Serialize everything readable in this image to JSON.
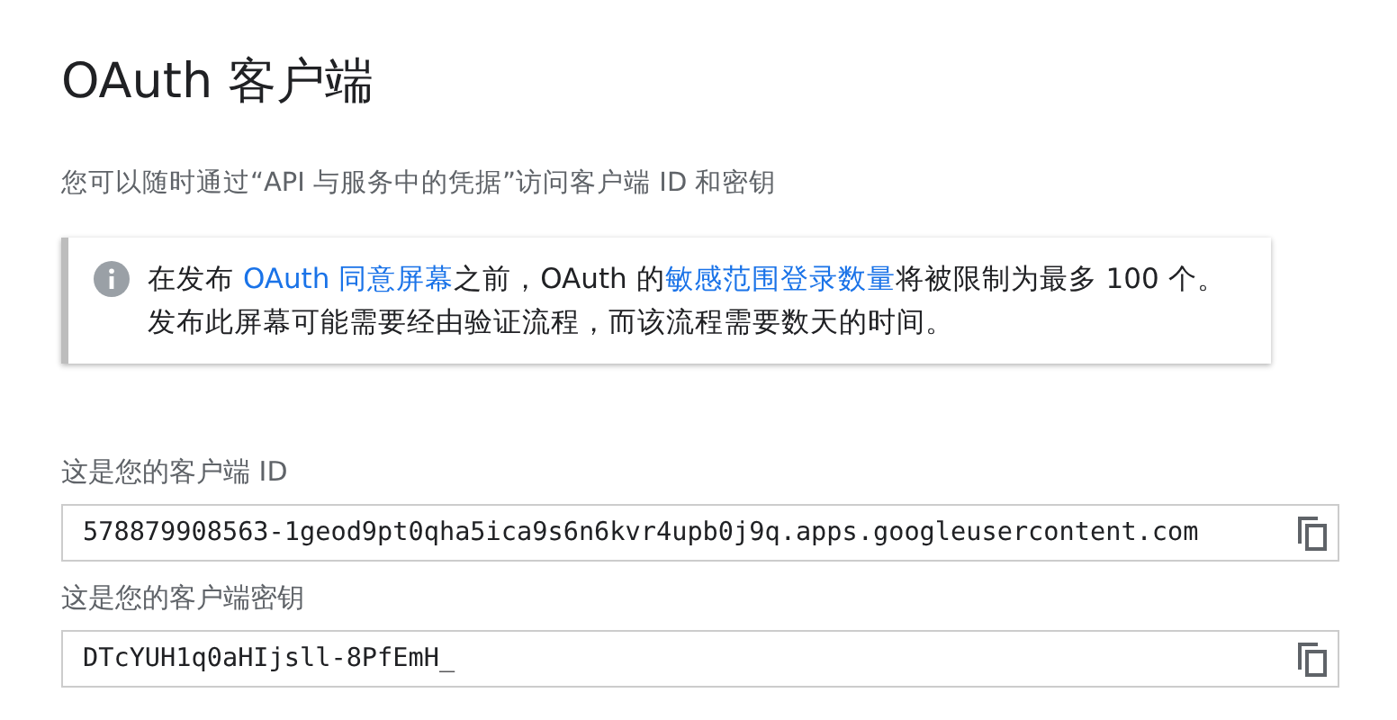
{
  "title": "OAuth 客户端",
  "subtitle": "您可以随时通过“API 与服务中的凭据”访问客户端 ID 和密钥",
  "notice": {
    "parts": [
      {
        "kind": "text",
        "text": "在发布 "
      },
      {
        "kind": "link",
        "text": "OAuth 同意屏幕"
      },
      {
        "kind": "text",
        "text": "之前，OAuth 的"
      },
      {
        "kind": "link",
        "text": "敏感范围登录数量"
      },
      {
        "kind": "text",
        "text": "将被限制为最多 100 个。发布此屏幕可能需要经由验证流程，而该流程需要数天的时间。"
      }
    ]
  },
  "fields": [
    {
      "label": "这是您的客户端 ID",
      "value": "578879908563-1geod9pt0qha5ica9s6n6kvr4upb0j9q.apps.googleusercontent.com"
    },
    {
      "label": "这是您的客户端密钥",
      "value": "DTcYUH1q0aHIjsll-8PfEmH_"
    }
  ]
}
